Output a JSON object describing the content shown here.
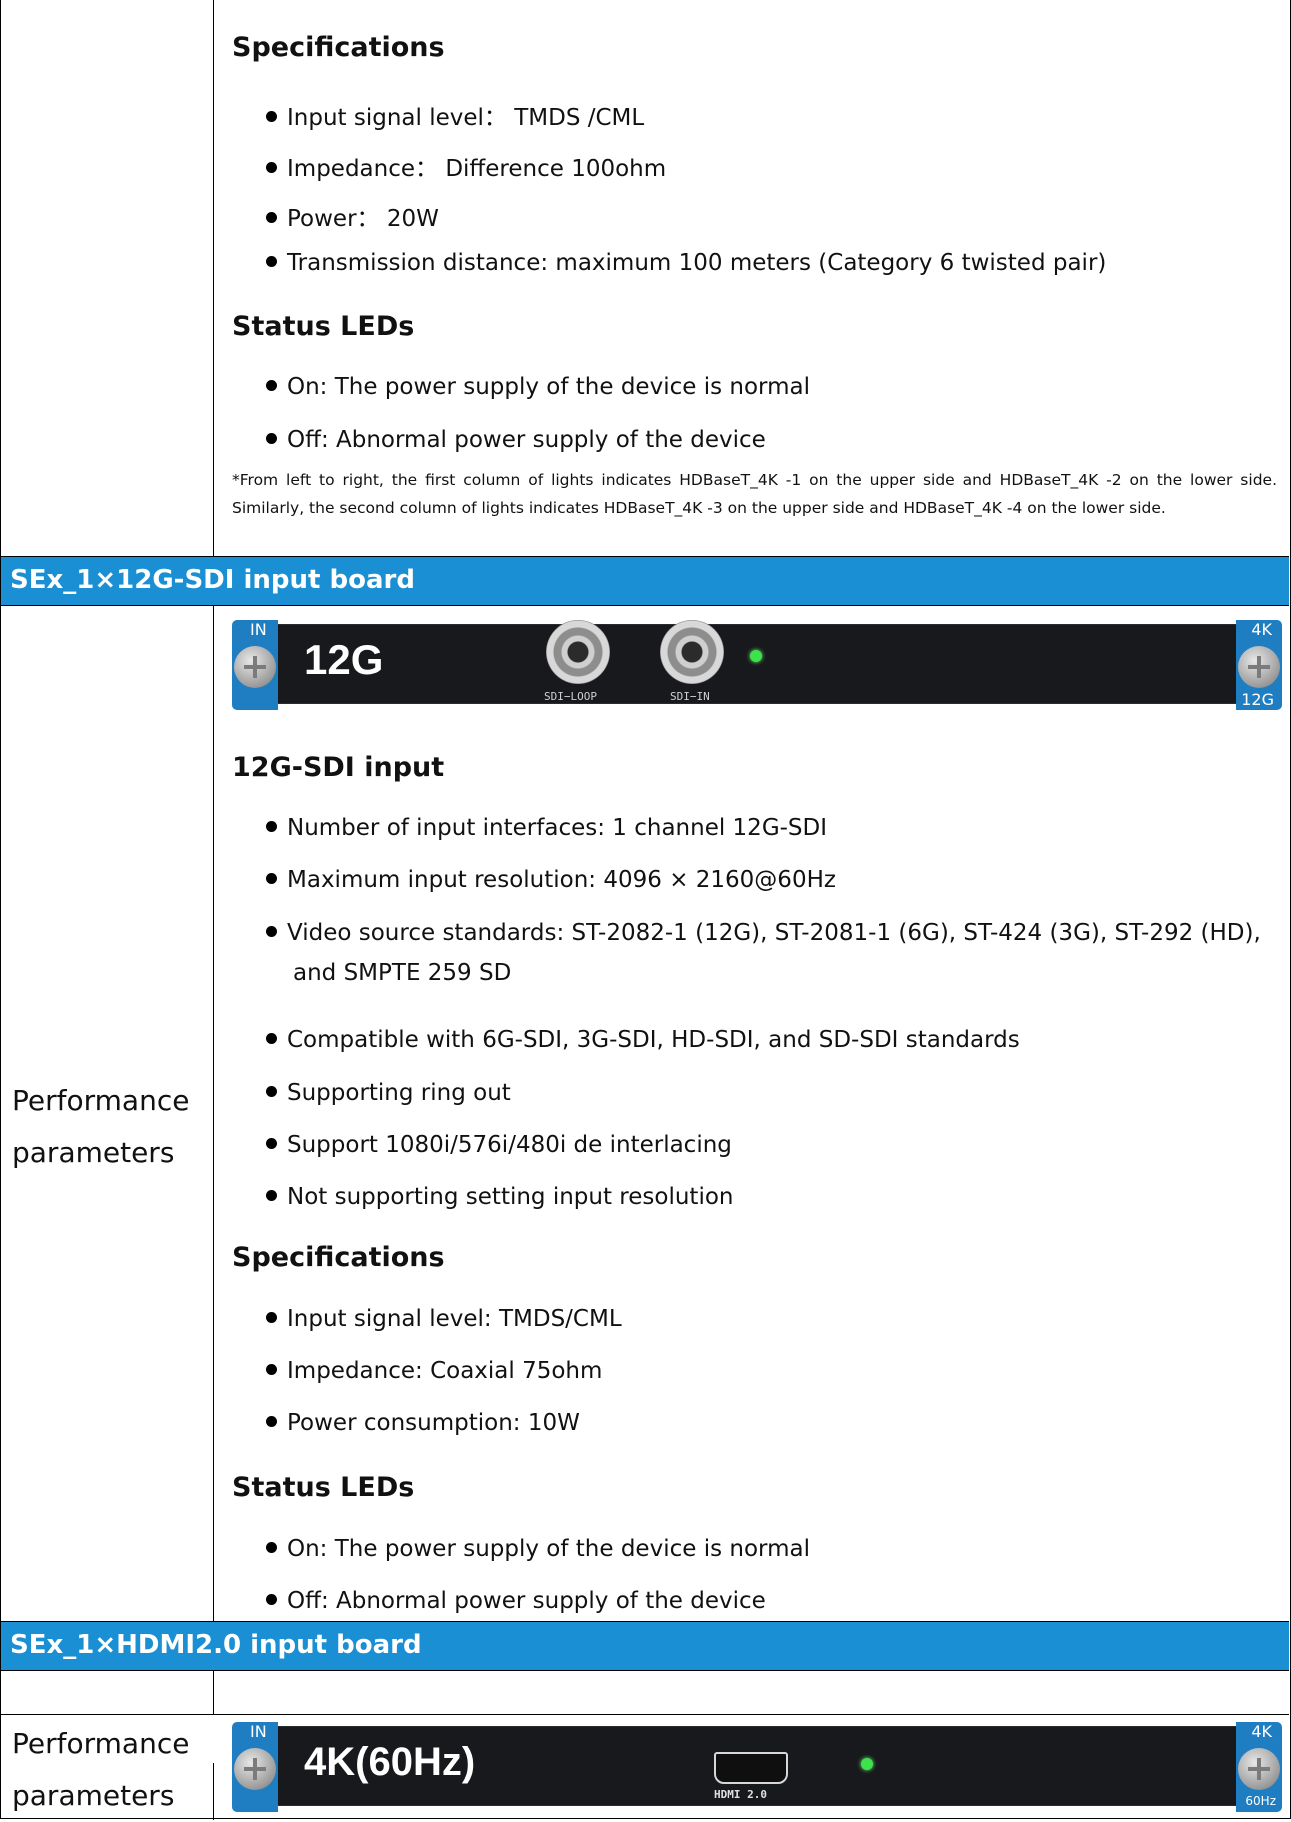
{
  "section0": {
    "specs_title": "Specifications",
    "specs": [
      "Input signal level： TMDS /CML",
      "Impedance： Difference 100ohm",
      "Power： 20W",
      "Transmission distance: maximum 100 meters (Category 6 twisted pair)"
    ],
    "leds_title": "Status LEDs",
    "leds": [
      "On: The power supply of the device is normal",
      "Off: Abnormal power supply of the device"
    ],
    "note": "*From left to right, the first column of lights indicates HDBaseT_4K -1 on the upper side and HDBaseT_4K -2 on the lower side. Similarly, the second column of lights indicates HDBaseT_4K -3 on the upper side and HDBaseT_4K -4 on the lower side."
  },
  "section1": {
    "header": "SEx_1×12G-SDI input board",
    "left_label_line1": "Performance",
    "left_label_line2": "parameters",
    "board": {
      "ear_left_text": "IN",
      "ear_right_top": "4K",
      "ear_right_bottom": "12G",
      "title": "12G",
      "port1_label": "SDI−LOOP",
      "port2_label": "SDI−IN"
    },
    "input_title": "12G-SDI input",
    "input": [
      "Number of input interfaces: 1 channel 12G-SDI",
      "Maximum input resolution: 4096 × 2160@60Hz",
      "Video source standards: ST-2082-1 (12G), ST-2081-1 (6G), ST-424 (3G), ST-292 (HD),",
      "and SMPTE 259 SD",
      "Compatible with 6G-SDI, 3G-SDI, HD-SDI, and SD-SDI standards",
      "Supporting ring out",
      "Support 1080i/576i/480i de interlacing",
      "Not supporting setting input resolution"
    ],
    "specs_title": "Specifications",
    "specs": [
      "Input signal level: TMDS/CML",
      "Impedance: Coaxial 75ohm",
      "Power consumption: 10W"
    ],
    "leds_title": "Status LEDs",
    "leds": [
      "On: The power supply of the device is normal",
      "Off: Abnormal power supply of the device"
    ]
  },
  "section2": {
    "header": "SEx_1×HDMI2.0 input board",
    "left_label_line1": "Performance",
    "left_label_line2": "parameters",
    "board": {
      "ear_left_text": "IN",
      "ear_right_top": "4K",
      "ear_right_bottom": "60Hz",
      "title": "4K(60Hz)",
      "port_label": "HDMI  2.0"
    }
  },
  "colors": {
    "header_bg": "#1a8fd3",
    "board_ear": "#1f7dc1",
    "board_body": "#18191c",
    "led": "#3ee24a"
  }
}
